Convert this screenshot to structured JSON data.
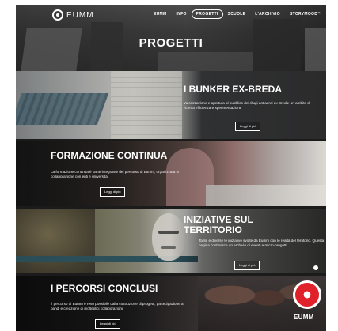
{
  "brand": {
    "logo_text": "EUMM"
  },
  "nav": {
    "items": [
      {
        "label": "EUMM",
        "active": false
      },
      {
        "label": "INFO",
        "active": false
      },
      {
        "label": "PROGETTI",
        "active": true
      },
      {
        "label": "SCUOLE",
        "active": false
      },
      {
        "label": "L'ARCHIVIO",
        "active": false
      },
      {
        "label": "STORYMOOD™",
        "active": false
      }
    ]
  },
  "page": {
    "title": "PROGETTI"
  },
  "sections": [
    {
      "title": "I BUNKER EX-BREDA",
      "description": "Valorizzazione e apertura al pubblico dei rifugi antiaerei ex Breda: un ambito di ricerca efficienza e sperimentazione",
      "button": "Leggi di più"
    },
    {
      "title": "FORMAZIONE CONTINUA",
      "description": "La formazione continua è parte integrante del percorso di Eumm, organizzata in collaborazione con enti e università",
      "button": "Leggi di più"
    },
    {
      "title": "INIZIATIVE SUL TERRITORIO",
      "description": "Tante e diverse le iniziative svolte da Eumm con le realtà del territorio. Questa pagina costituisce un archivio di eventi e micro-progetti",
      "button": "Leggi di più"
    },
    {
      "title": "I PERCORSI CONCLUSI",
      "description": "Il percorso di Eumm è reso possibile dalla costruzione di progetti, partecipazione a bandi e creazione di molteplici collaborazioni",
      "button": "Leggi di più"
    }
  ],
  "badge": {
    "label": "EUMM"
  },
  "colors": {
    "accent_red": "#e0212b",
    "text_white": "#ffffff"
  }
}
